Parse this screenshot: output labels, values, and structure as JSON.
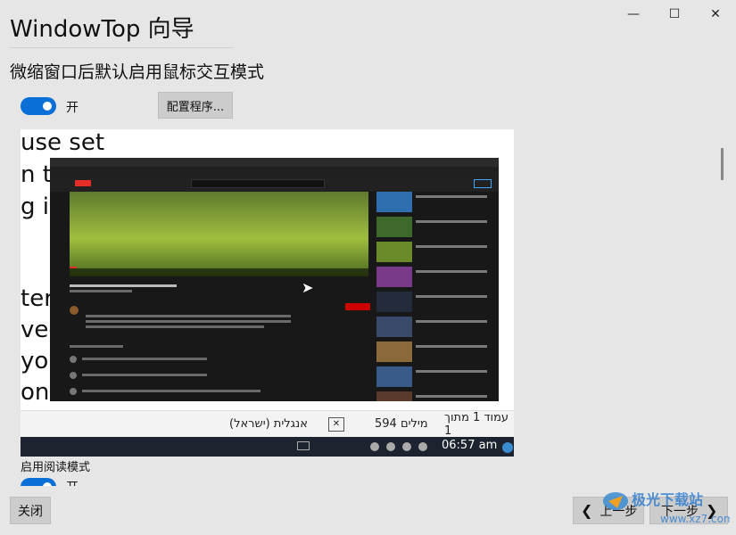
{
  "window": {
    "minimize_icon": "—",
    "maximize_icon": "☐",
    "close_icon": "✕"
  },
  "wizard": {
    "title": "WindowTop 向导",
    "subtitle": "微缩窗口后默认启用鼠标交互模式",
    "toggle1_label": "开",
    "configure_button": "配置程序...",
    "reading_mode_label": "启用阅读模式",
    "toggle2_label": "开",
    "close_button": "关闭",
    "prev_button": "上一步",
    "next_button": "下一步",
    "prev_icon": "❮",
    "next_icon": "❯"
  },
  "preview": {
    "doc_lines": [
      "use set",
      "n t",
      "g i",
      "tern",
      "ved",
      "you",
      "on"
    ],
    "wordbar": {
      "page_info": "עמוד 1 מתוך 1",
      "word_count": "594 מילים",
      "language": "אנגלית (ישראל)"
    },
    "taskbar": {
      "time": "06:57 am"
    }
  },
  "colors": {
    "accent": "#0a6fd6",
    "background": "#e6e6e6"
  }
}
